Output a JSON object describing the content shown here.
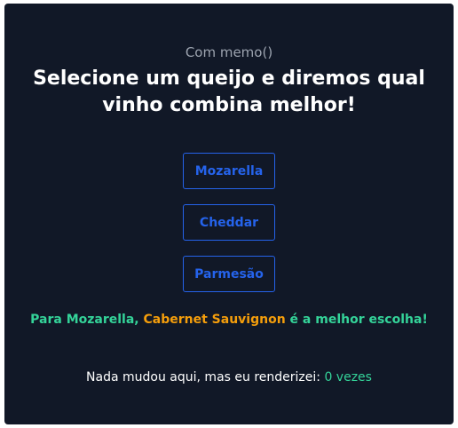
{
  "header": {
    "subtitle": "Com memo()",
    "title_line1": "Selecione um queijo e diremos qual",
    "title_line2": "vinho combina melhor!"
  },
  "cheeses": [
    {
      "label": "Mozarella"
    },
    {
      "label": "Cheddar"
    },
    {
      "label": "Parmesão"
    }
  ],
  "result": {
    "prefix": "Para Mozarella, ",
    "wine": "Cabernet Sauvignon",
    "suffix": " é a melhor escolha!"
  },
  "render_info": {
    "text": "Nada mudou aqui, mas eu renderizei: ",
    "count": "0 vezes"
  },
  "colors": {
    "background": "#111827",
    "accent_blue": "#2563eb",
    "accent_green": "#34d399",
    "accent_orange": "#f59e0b"
  }
}
